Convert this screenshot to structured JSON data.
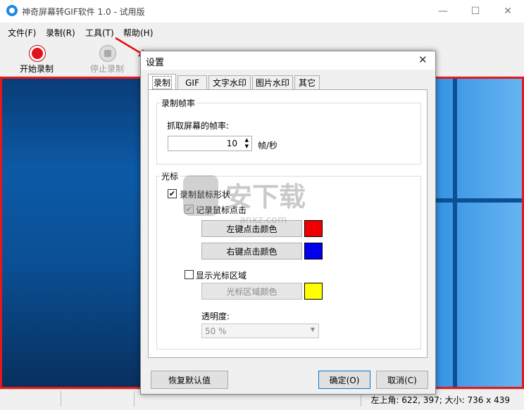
{
  "app": {
    "title": "神奇屏幕转GIF软件 1.0 - 试用版",
    "window_controls": {
      "minimize": "—",
      "maximize": "☐",
      "close": "✕"
    }
  },
  "menu": [
    "文件(F)",
    "录制(R)",
    "工具(T)",
    "帮助(H)"
  ],
  "toolbar": {
    "start_label": "开始录制",
    "stop_label": "停止录制"
  },
  "status": {
    "text": "左上角: 622, 397; 大小: 736 x 439"
  },
  "dialog": {
    "title": "设置",
    "close": "✕",
    "tabs": [
      "录制",
      "GIF",
      "文字水印",
      "图片水印",
      "其它"
    ],
    "active_tab": "录制",
    "framerate_group": "录制帧率",
    "framerate_label": "抓取屏幕的帧率:",
    "framerate_value": "10",
    "framerate_unit": "帧/秒",
    "cursor_group": "光标",
    "record_cursor_shape": {
      "label": "录制鼠标形状",
      "checked": true
    },
    "record_click": {
      "label": "记录鼠标点击",
      "checked": true
    },
    "left_click_button": "左键点击颜色",
    "right_click_button": "右键点击颜色",
    "show_cursor_area": {
      "label": "显示光标区域",
      "checked": false
    },
    "cursor_area_button": "光标区域颜色",
    "opacity_label": "透明度:",
    "opacity_value": "50 %",
    "reset_button": "恢复默认值",
    "ok_button": "确定(O)",
    "cancel_button": "取消(C)",
    "colors": {
      "left_click": "#ee0000",
      "right_click": "#0000ee",
      "cursor_area": "#ffff00"
    }
  },
  "watermark": {
    "text": "安下载",
    "sub": "anxz.com"
  },
  "icons": {
    "app": "app-icon",
    "record": "record-icon",
    "stop": "stop-icon",
    "arrow": "red-arrow"
  }
}
